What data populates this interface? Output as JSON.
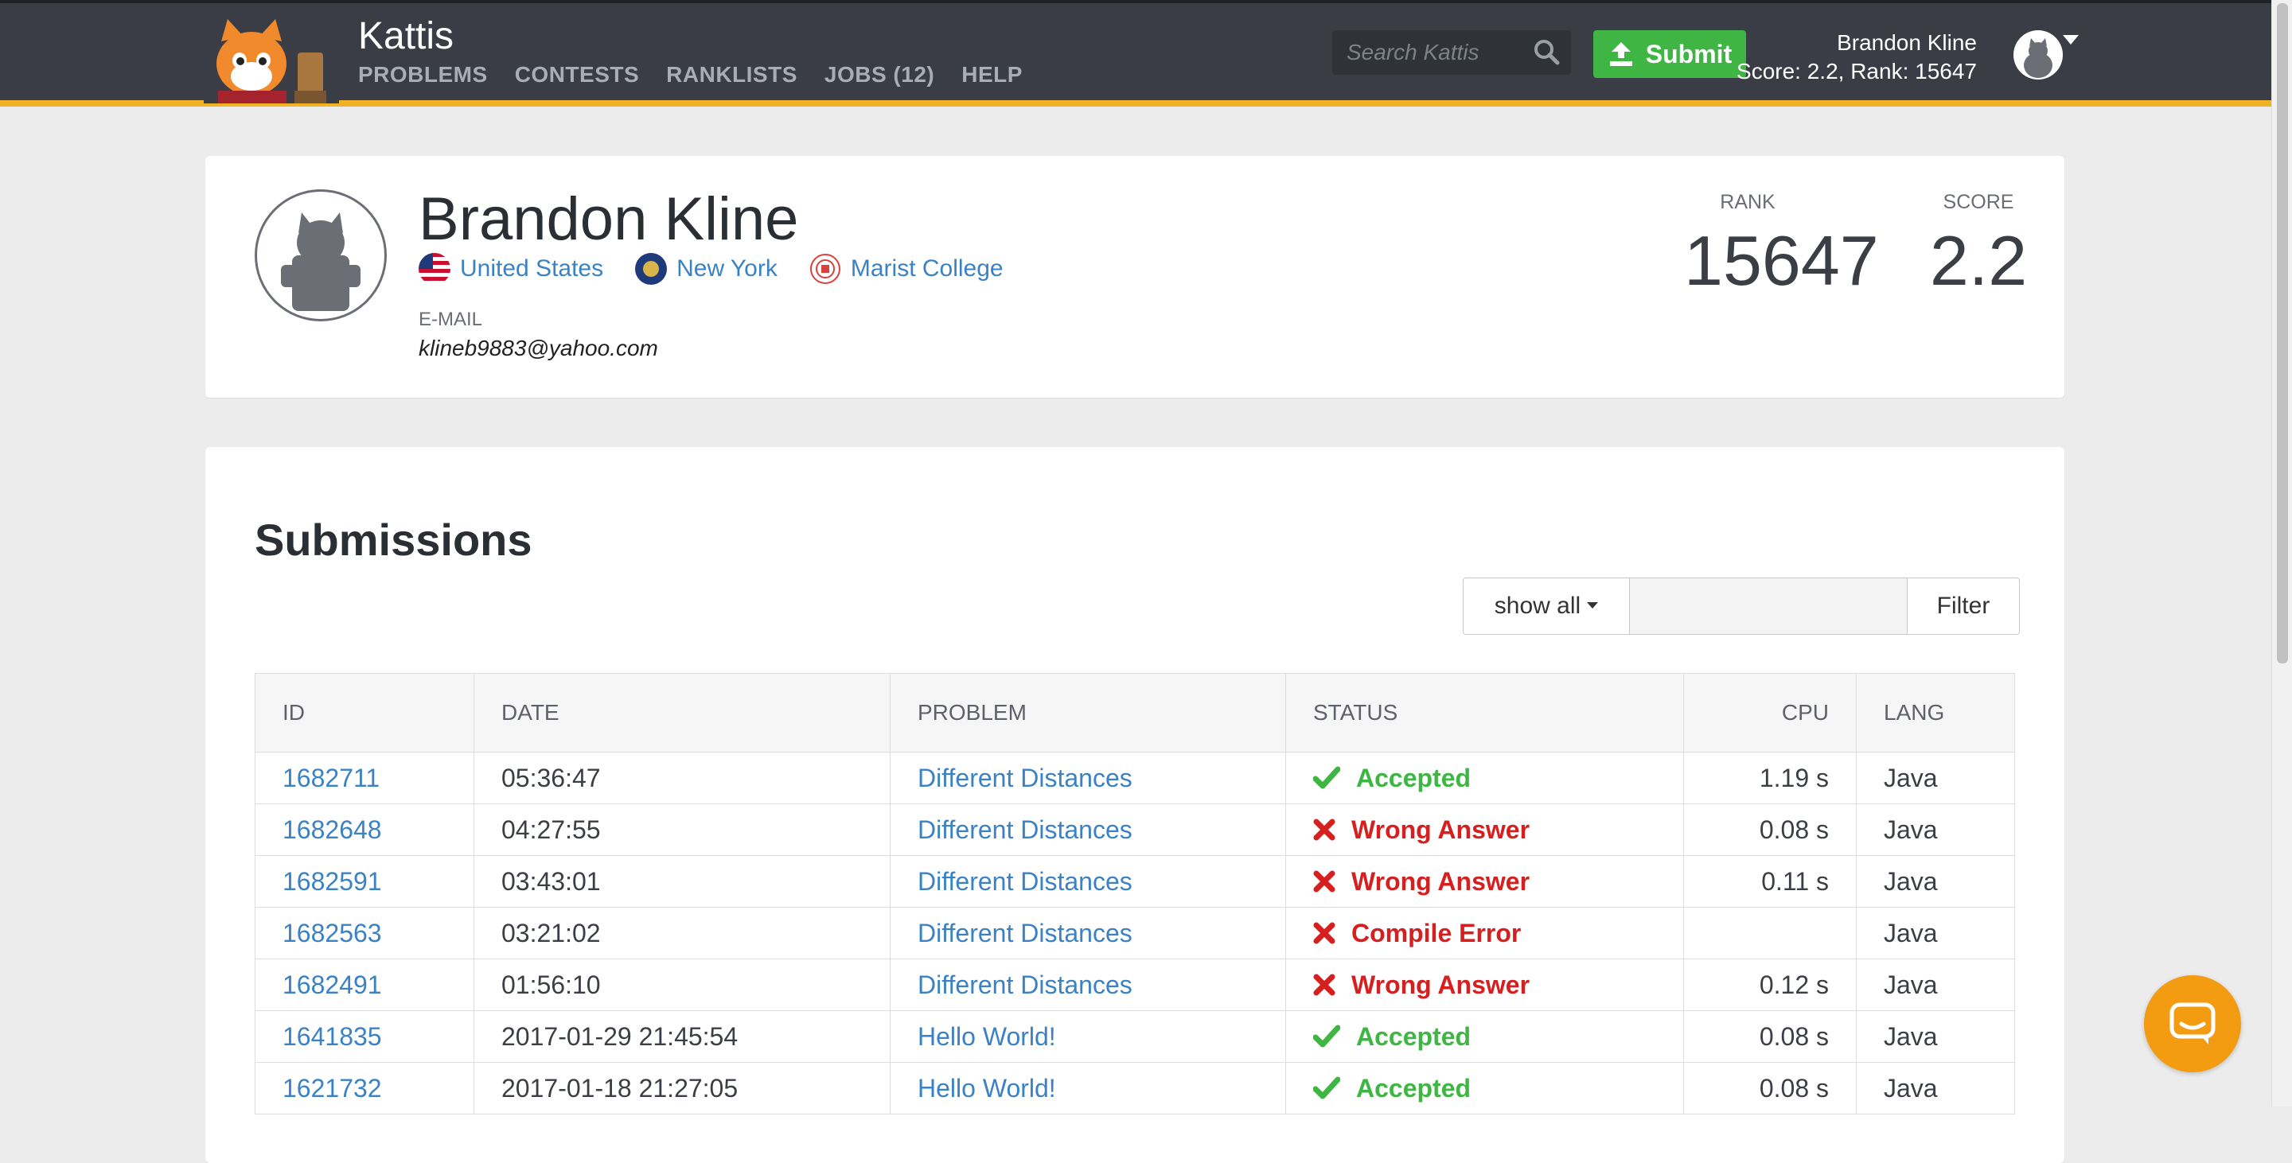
{
  "header": {
    "brand": "Kattis",
    "nav": [
      "PROBLEMS",
      "CONTESTS",
      "RANKLISTS",
      "JOBS (12)",
      "HELP"
    ],
    "search_placeholder": "Search Kattis",
    "submit_label": "Submit",
    "user_name": "Brandon Kline",
    "user_stats": "Score: 2.2, Rank: 15647"
  },
  "profile": {
    "name": "Brandon Kline",
    "country": "United States",
    "region": "New York",
    "school": "Marist College",
    "email_label": "E-MAIL",
    "email": "klineb9883@yahoo.com",
    "rank_label": "RANK",
    "rank": "15647",
    "score_label": "SCORE",
    "score": "2.2"
  },
  "submissions": {
    "title": "Submissions",
    "filter_select": "show all",
    "filter_button": "Filter",
    "columns": [
      "ID",
      "DATE",
      "PROBLEM",
      "STATUS",
      "CPU",
      "LANG"
    ],
    "rows": [
      {
        "id": "1682711",
        "date": "05:36:47",
        "problem": "Different Distances",
        "status": "Accepted",
        "ok": true,
        "cpu": "1.19 s",
        "lang": "Java"
      },
      {
        "id": "1682648",
        "date": "04:27:55",
        "problem": "Different Distances",
        "status": "Wrong Answer",
        "ok": false,
        "cpu": "0.08 s",
        "lang": "Java"
      },
      {
        "id": "1682591",
        "date": "03:43:01",
        "problem": "Different Distances",
        "status": "Wrong Answer",
        "ok": false,
        "cpu": "0.11 s",
        "lang": "Java"
      },
      {
        "id": "1682563",
        "date": "03:21:02",
        "problem": "Different Distances",
        "status": "Compile Error",
        "ok": false,
        "cpu": "",
        "lang": "Java"
      },
      {
        "id": "1682491",
        "date": "01:56:10",
        "problem": "Different Distances",
        "status": "Wrong Answer",
        "ok": false,
        "cpu": "0.12 s",
        "lang": "Java"
      },
      {
        "id": "1641835",
        "date": "2017-01-29 21:45:54",
        "problem": "Hello World!",
        "status": "Accepted",
        "ok": true,
        "cpu": "0.08 s",
        "lang": "Java"
      },
      {
        "id": "1621732",
        "date": "2017-01-18 21:27:05",
        "problem": "Hello World!",
        "status": "Accepted",
        "ok": true,
        "cpu": "0.08 s",
        "lang": "Java"
      }
    ]
  },
  "colors": {
    "accent": "#f0b323",
    "header_bg": "#3a3d45",
    "link": "#3b82c4",
    "ok": "#3fb643",
    "bad": "#d61f1f",
    "chat": "#f39c12"
  },
  "icons": {
    "search": "search-icon",
    "submit": "upload-icon",
    "accepted": "check-icon",
    "rejected": "cross-icon",
    "chat": "chat-icon"
  }
}
